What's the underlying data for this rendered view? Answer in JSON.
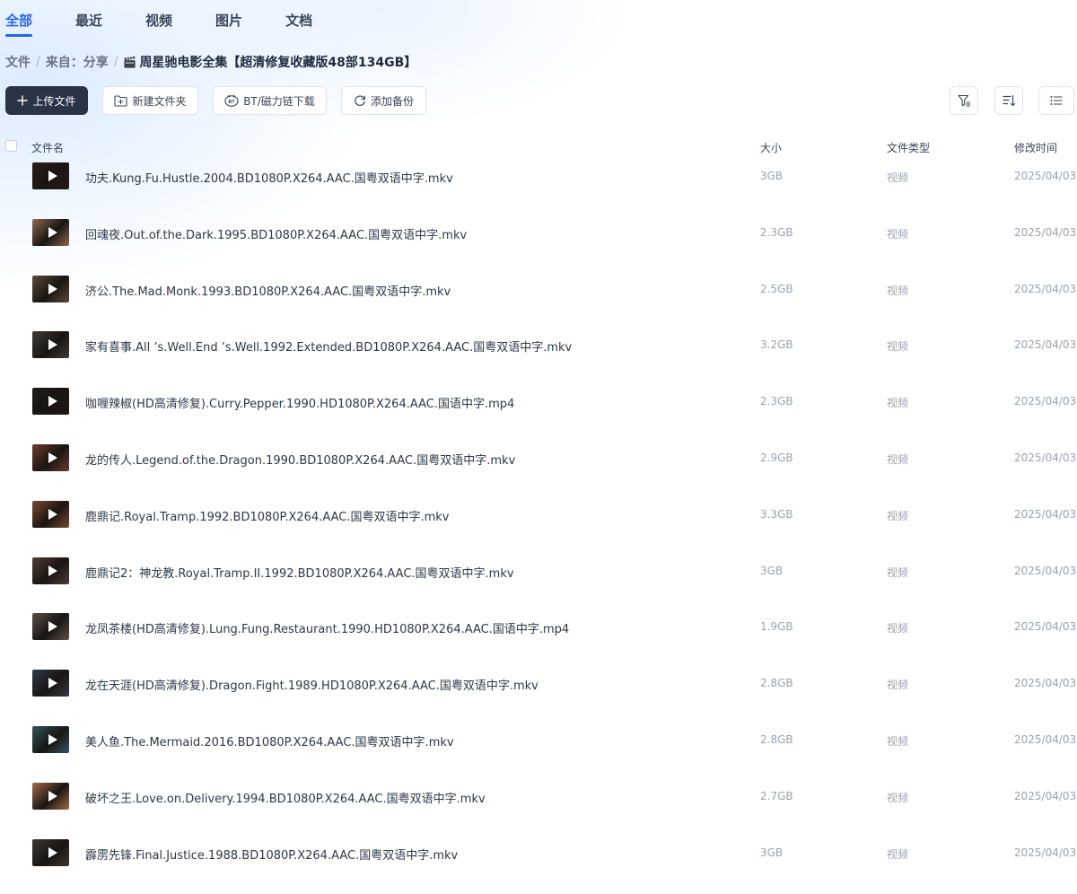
{
  "tabs": [
    {
      "label": "全部",
      "active": true
    },
    {
      "label": "最近",
      "active": false
    },
    {
      "label": "视频",
      "active": false
    },
    {
      "label": "图片",
      "active": false
    },
    {
      "label": "文档",
      "active": false
    }
  ],
  "breadcrumb": {
    "root": "文件",
    "from": "来自：分享",
    "separator": "/",
    "current": "周星驰电影全集【超清修复收藏版48部134GB】",
    "current_icon": "clapperboard-icon"
  },
  "toolbar": {
    "upload_label": "上传文件",
    "new_folder_label": "新建文件夹",
    "bt_label": "BT/磁力链下载",
    "backup_label": "添加备份",
    "right_icons": [
      "filter-icon",
      "sort-icon",
      "list-view-icon"
    ]
  },
  "table": {
    "headers": {
      "name": "文件名",
      "size": "大小",
      "type": "文件类型",
      "date": "修改时间"
    },
    "rows": [
      {
        "name": "功夫.Kung.Fu.Hustle.2004.BD1080P.X264.AAC.国粤双语中字.mkv",
        "size": "3GB",
        "type": "视频",
        "date": "2025/04/03"
      },
      {
        "name": "回魂夜.Out.of.the.Dark.1995.BD1080P.X264.AAC.国粤双语中字.mkv",
        "size": "2.3GB",
        "type": "视频",
        "date": "2025/04/03"
      },
      {
        "name": "济公.The.Mad.Monk.1993.BD1080P.X264.AAC.国粤双语中字.mkv",
        "size": "2.5GB",
        "type": "视频",
        "date": "2025/04/03"
      },
      {
        "name": "家有喜事.All ’s.Well.End ’s.Well.1992.Extended.BD1080P.X264.AAC.国粤双语中字.mkv",
        "size": "3.2GB",
        "type": "视频",
        "date": "2025/04/03"
      },
      {
        "name": "咖喱辣椒(HD高清修复).Curry.Pepper.1990.HD1080P.X264.AAC.国语中字.mp4",
        "size": "2.3GB",
        "type": "视频",
        "date": "2025/04/03"
      },
      {
        "name": "龙的传人.Legend.of.the.Dragon.1990.BD1080P.X264.AAC.国粤双语中字.mkv",
        "size": "2.9GB",
        "type": "视频",
        "date": "2025/04/03"
      },
      {
        "name": "鹿鼎记.Royal.Tramp.1992.BD1080P.X264.AAC.国粤双语中字.mkv",
        "size": "3.3GB",
        "type": "视频",
        "date": "2025/04/03"
      },
      {
        "name": "鹿鼎记2：神龙教.Royal.Tramp.II.1992.BD1080P.X264.AAC.国粤双语中字.mkv",
        "size": "3GB",
        "type": "视频",
        "date": "2025/04/03"
      },
      {
        "name": "龙凤茶楼(HD高清修复).Lung.Fung.Restaurant.1990.HD1080P.X264.AAC.国语中字.mp4",
        "size": "1.9GB",
        "type": "视频",
        "date": "2025/04/03"
      },
      {
        "name": "龙在天涯(HD高清修复).Dragon.Fight.1989.HD1080P.X264.AAC.国粤双语中字.mkv",
        "size": "2.8GB",
        "type": "视频",
        "date": "2025/04/03"
      },
      {
        "name": "美人鱼.The.Mermaid.2016.BD1080P.X264.AAC.国粤双语中字.mkv",
        "size": "2.8GB",
        "type": "视频",
        "date": "2025/04/03"
      },
      {
        "name": "破坏之王.Love.on.Delivery.1994.BD1080P.X264.AAC.国粤双语中字.mkv",
        "size": "2.7GB",
        "type": "视频",
        "date": "2025/04/03"
      },
      {
        "name": "霹雳先锋.Final.Justice.1988.BD1080P.X264.AAC.国粤双语中字.mkv",
        "size": "3GB",
        "type": "视频",
        "date": "2025/04/03"
      }
    ]
  },
  "colors": {
    "accent": "#2764f0",
    "primary_button": "#2b3346",
    "muted_text": "#9ba2ae",
    "thumbnail_tones": [
      "#2a1d18",
      "#8a6a52",
      "#5c4a3c",
      "#3f3a36",
      "#1f1a16",
      "#6b3d2e",
      "#7a4a30",
      "#4e3c35",
      "#5a5048",
      "#2d3a4a",
      "#2f5560",
      "#a36a4a",
      "#3d3530"
    ]
  }
}
